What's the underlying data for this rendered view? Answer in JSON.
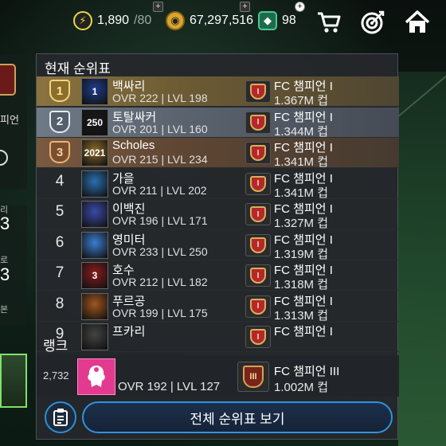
{
  "topbar": {
    "energy": {
      "value": "1,890",
      "max": "/80"
    },
    "coins": "67,297,516",
    "gems": "98",
    "plus": "+"
  },
  "left_panel": {
    "label": "피언",
    "num1": "3",
    "num2": "3",
    "small1": "리",
    "small2": "로",
    "small3": "본"
  },
  "panel": {
    "title": "현재 순위표",
    "rows": [
      {
        "rank": "1",
        "name": "백싸리",
        "stat": "OVR 222 | LVL 198",
        "tier": "FC 챔피언 I",
        "points": "1.367M 컵",
        "avatar_text": "1",
        "avatar_color": "#1f3d8c"
      },
      {
        "rank": "2",
        "name": "토탈싸커",
        "stat": "OVR 201 | LVL 160",
        "tier": "FC 챔피언 I",
        "points": "1.344M 컵",
        "avatar_text": "250",
        "avatar_color": "#1a1a1a"
      },
      {
        "rank": "3",
        "name": "Scholes",
        "stat": "OVR 215 | LVL 234",
        "tier": "FC 챔피언 I",
        "points": "1.341M 컵",
        "avatar_text": "2021",
        "avatar_color": "#8b6a2a"
      },
      {
        "rank": "4",
        "name": "가을",
        "stat": "OVR 211 | LVL 202",
        "tier": "FC 챔피언 I",
        "points": "1.341M 컵",
        "avatar_text": "",
        "avatar_color": "#2a6fb0"
      },
      {
        "rank": "5",
        "name": "이백진",
        "stat": "OVR 196 | LVL 171",
        "tier": "FC 챔피언 I",
        "points": "1.327M 컵",
        "avatar_text": "",
        "avatar_color": "#3a4aa8"
      },
      {
        "rank": "6",
        "name": "영미터",
        "stat": "OVR 233 | LVL 250",
        "tier": "FC 챔피언 I",
        "points": "1.319M 컵",
        "avatar_text": "",
        "avatar_color": "#3b7dd0"
      },
      {
        "rank": "7",
        "name": "호수",
        "stat": "OVR 212 | LVL 182",
        "tier": "FC 챔피언 I",
        "points": "1.318M 컵",
        "avatar_text": "3",
        "avatar_color": "#8a1c1c"
      },
      {
        "rank": "8",
        "name": "푸르공",
        "stat": "OVR 199 | LVL 175",
        "tier": "FC 챔피언 I",
        "points": "1.313M 컵",
        "avatar_text": "",
        "avatar_color": "#a0561e"
      },
      {
        "rank": "9",
        "name": "프카리",
        "stat": "",
        "tier": "FC 챔피언 I",
        "points": "",
        "avatar_text": "",
        "avatar_color": "#444"
      }
    ],
    "trophy_mark": "I"
  },
  "my_rank": {
    "title": "랭크",
    "rank": "2,732",
    "stat": "OVR 192 | LVL 127",
    "tier": "FC 챔피언 III",
    "points": "1.002M 컵",
    "trophy_mark": "III",
    "avatar_color": "#e23a8e"
  },
  "actions": {
    "full_leaderboard": "전체 순위표 보기"
  },
  "colors": {
    "gold_row": "#8a7340",
    "silver_row": "#6e7a86",
    "bronze_row": "#7a5a40",
    "button_border": "#2f93e0"
  }
}
